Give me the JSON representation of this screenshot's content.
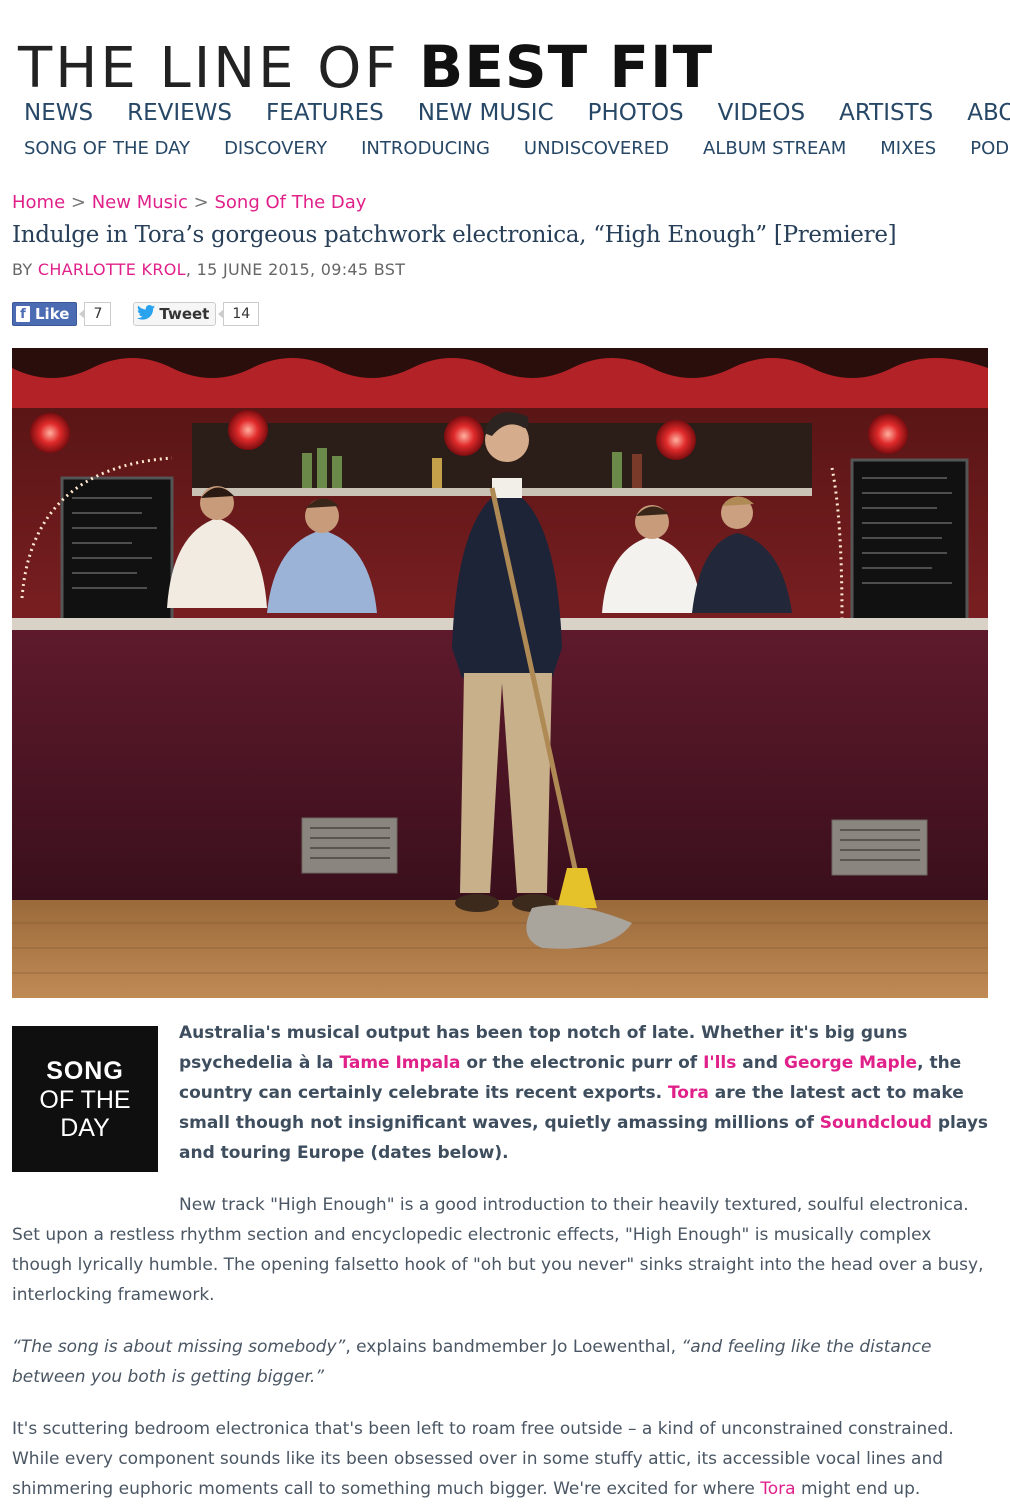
{
  "site": {
    "logo_light": "THE LINE OF",
    "logo_bold": "BEST FIT"
  },
  "nav_primary": [
    "NEWS",
    "REVIEWS",
    "FEATURES",
    "NEW MUSIC",
    "PHOTOS",
    "VIDEOS",
    "ARTISTS",
    "ABOUT"
  ],
  "nav_secondary": [
    "SONG OF THE DAY",
    "DISCOVERY",
    "INTRODUCING",
    "UNDISCOVERED",
    "ALBUM STREAM",
    "MIXES",
    "PODCAST"
  ],
  "breadcrumb": {
    "home": "Home",
    "sep": ">",
    "section": "New Music",
    "subsection": "Song Of The Day"
  },
  "article": {
    "title": "Indulge in Tora’s gorgeous patchwork electronica, “High Enough” [Premiere]",
    "by_prefix": "BY",
    "author": "CHARLOTTE KROL",
    "date": ", 15 JUNE 2015, 09:45 BST"
  },
  "social": {
    "fb_icon": "f",
    "like_label": "Like",
    "like_count": "7",
    "tweet_label": "Tweet",
    "tweet_count": "14"
  },
  "badge": {
    "line1": "SONG",
    "line2": "OF THE",
    "line3": "DAY"
  },
  "lead": {
    "t1": "Australia's musical output has been top notch of late. Whether it's big guns psychedelia à la ",
    "l1": "Tame Impala",
    "t2": " or the electronic purr of ",
    "l2": "I'lls",
    "t3": " and ",
    "l3": "George Maple",
    "t4": ", the country can certainly celebrate its recent exports. ",
    "l4": "Tora",
    "t5": " are the latest act to make small though not insignificant waves, quietly amassing millions of ",
    "l5": "Soundcloud",
    "t6": " plays and touring Europe (dates below)."
  },
  "body": {
    "p1": "New track \"High Enough\" is a good introduction to their heavily textured, soulful electronica. Set upon a restless rhythm section and encyclopedic electronic effects, \"High Enough\" is musically complex though lyrically humble. The opening falsetto hook of \"oh but you never\" sinks straight into the head over a busy, interlocking framework.",
    "p2_q1": "“The song is about missing somebody”",
    "p2_mid": ", explains bandmember Jo Loewenthal, ",
    "p2_q2": "“and feeling like the distance between you both is getting bigger.”",
    "p3_text": "It's scuttering bedroom electronica that's been left to roam free outside – a kind of unconstrained constrained. While every component sounds like its been obsessed over in some stuffy attic, its accessible vocal lines and shimmering euphoric moments call to something much bigger. We're excited for where ",
    "p3_link": "Tora",
    "p3_end": " might end up."
  }
}
